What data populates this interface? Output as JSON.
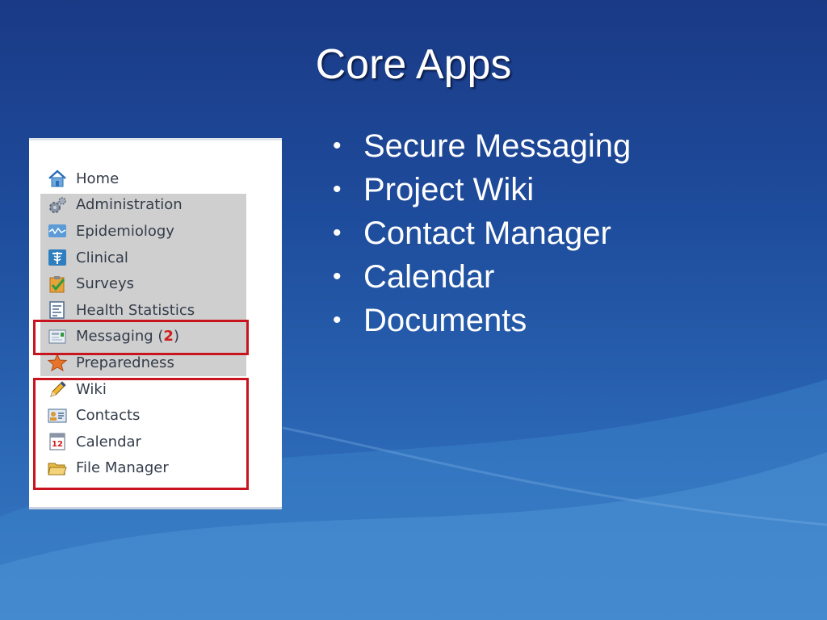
{
  "slide": {
    "title": "Core Apps",
    "bullets": [
      "Secure Messaging",
      "Project Wiki",
      "Contact Manager",
      "Calendar",
      "Documents"
    ],
    "bullet_glyph": "•"
  },
  "menu": {
    "items": [
      {
        "label": "Home",
        "icon": "home-icon"
      },
      {
        "label": "Administration",
        "icon": "gears-icon"
      },
      {
        "label": "Epidemiology",
        "icon": "chart-wave-icon"
      },
      {
        "label": "Clinical",
        "icon": "caduceus-icon"
      },
      {
        "label": "Surveys",
        "icon": "clipboard-check-icon"
      },
      {
        "label": "Health Statistics",
        "icon": "document-list-icon"
      },
      {
        "label": "Messaging",
        "count": "2",
        "icon": "message-icon"
      },
      {
        "label": "Preparedness",
        "icon": "star-icon"
      },
      {
        "label": "Wiki",
        "icon": "pencil-icon"
      },
      {
        "label": "Contacts",
        "icon": "contacts-card-icon"
      },
      {
        "label": "Calendar",
        "icon": "calendar-icon",
        "icon_text": "12"
      },
      {
        "label": "File Manager",
        "icon": "folder-icon"
      }
    ]
  },
  "colors": {
    "highlight_border": "#c8141e",
    "count_color": "#d01d1d",
    "disabled_block": "#cfcfcf"
  }
}
